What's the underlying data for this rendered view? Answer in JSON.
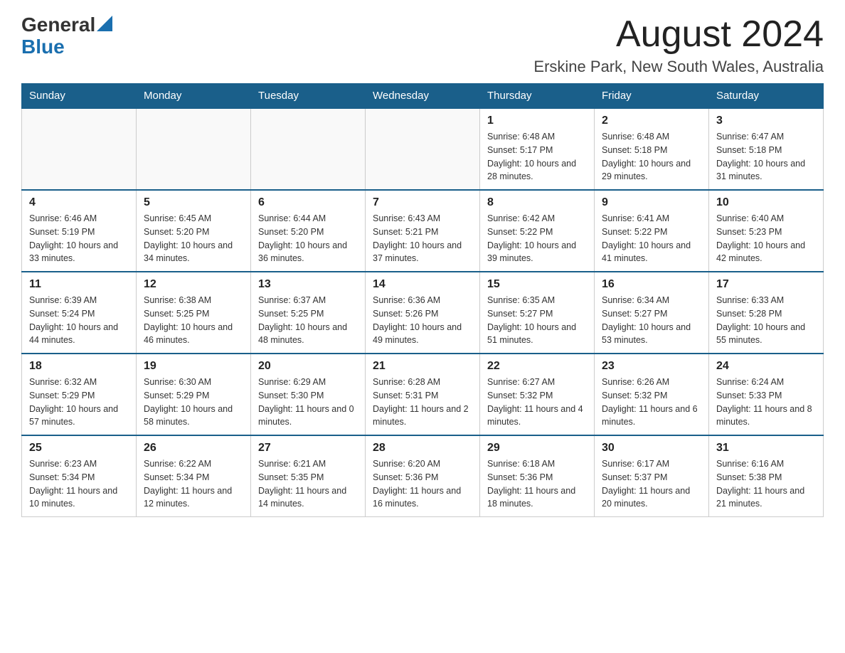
{
  "header": {
    "logo_line1": "General",
    "logo_line2": "Blue",
    "month_title": "August 2024",
    "location": "Erskine Park, New South Wales, Australia"
  },
  "weekdays": [
    "Sunday",
    "Monday",
    "Tuesday",
    "Wednesday",
    "Thursday",
    "Friday",
    "Saturday"
  ],
  "weeks": [
    [
      {
        "day": "",
        "info": ""
      },
      {
        "day": "",
        "info": ""
      },
      {
        "day": "",
        "info": ""
      },
      {
        "day": "",
        "info": ""
      },
      {
        "day": "1",
        "info": "Sunrise: 6:48 AM\nSunset: 5:17 PM\nDaylight: 10 hours and 28 minutes."
      },
      {
        "day": "2",
        "info": "Sunrise: 6:48 AM\nSunset: 5:18 PM\nDaylight: 10 hours and 29 minutes."
      },
      {
        "day": "3",
        "info": "Sunrise: 6:47 AM\nSunset: 5:18 PM\nDaylight: 10 hours and 31 minutes."
      }
    ],
    [
      {
        "day": "4",
        "info": "Sunrise: 6:46 AM\nSunset: 5:19 PM\nDaylight: 10 hours and 33 minutes."
      },
      {
        "day": "5",
        "info": "Sunrise: 6:45 AM\nSunset: 5:20 PM\nDaylight: 10 hours and 34 minutes."
      },
      {
        "day": "6",
        "info": "Sunrise: 6:44 AM\nSunset: 5:20 PM\nDaylight: 10 hours and 36 minutes."
      },
      {
        "day": "7",
        "info": "Sunrise: 6:43 AM\nSunset: 5:21 PM\nDaylight: 10 hours and 37 minutes."
      },
      {
        "day": "8",
        "info": "Sunrise: 6:42 AM\nSunset: 5:22 PM\nDaylight: 10 hours and 39 minutes."
      },
      {
        "day": "9",
        "info": "Sunrise: 6:41 AM\nSunset: 5:22 PM\nDaylight: 10 hours and 41 minutes."
      },
      {
        "day": "10",
        "info": "Sunrise: 6:40 AM\nSunset: 5:23 PM\nDaylight: 10 hours and 42 minutes."
      }
    ],
    [
      {
        "day": "11",
        "info": "Sunrise: 6:39 AM\nSunset: 5:24 PM\nDaylight: 10 hours and 44 minutes."
      },
      {
        "day": "12",
        "info": "Sunrise: 6:38 AM\nSunset: 5:25 PM\nDaylight: 10 hours and 46 minutes."
      },
      {
        "day": "13",
        "info": "Sunrise: 6:37 AM\nSunset: 5:25 PM\nDaylight: 10 hours and 48 minutes."
      },
      {
        "day": "14",
        "info": "Sunrise: 6:36 AM\nSunset: 5:26 PM\nDaylight: 10 hours and 49 minutes."
      },
      {
        "day": "15",
        "info": "Sunrise: 6:35 AM\nSunset: 5:27 PM\nDaylight: 10 hours and 51 minutes."
      },
      {
        "day": "16",
        "info": "Sunrise: 6:34 AM\nSunset: 5:27 PM\nDaylight: 10 hours and 53 minutes."
      },
      {
        "day": "17",
        "info": "Sunrise: 6:33 AM\nSunset: 5:28 PM\nDaylight: 10 hours and 55 minutes."
      }
    ],
    [
      {
        "day": "18",
        "info": "Sunrise: 6:32 AM\nSunset: 5:29 PM\nDaylight: 10 hours and 57 minutes."
      },
      {
        "day": "19",
        "info": "Sunrise: 6:30 AM\nSunset: 5:29 PM\nDaylight: 10 hours and 58 minutes."
      },
      {
        "day": "20",
        "info": "Sunrise: 6:29 AM\nSunset: 5:30 PM\nDaylight: 11 hours and 0 minutes."
      },
      {
        "day": "21",
        "info": "Sunrise: 6:28 AM\nSunset: 5:31 PM\nDaylight: 11 hours and 2 minutes."
      },
      {
        "day": "22",
        "info": "Sunrise: 6:27 AM\nSunset: 5:32 PM\nDaylight: 11 hours and 4 minutes."
      },
      {
        "day": "23",
        "info": "Sunrise: 6:26 AM\nSunset: 5:32 PM\nDaylight: 11 hours and 6 minutes."
      },
      {
        "day": "24",
        "info": "Sunrise: 6:24 AM\nSunset: 5:33 PM\nDaylight: 11 hours and 8 minutes."
      }
    ],
    [
      {
        "day": "25",
        "info": "Sunrise: 6:23 AM\nSunset: 5:34 PM\nDaylight: 11 hours and 10 minutes."
      },
      {
        "day": "26",
        "info": "Sunrise: 6:22 AM\nSunset: 5:34 PM\nDaylight: 11 hours and 12 minutes."
      },
      {
        "day": "27",
        "info": "Sunrise: 6:21 AM\nSunset: 5:35 PM\nDaylight: 11 hours and 14 minutes."
      },
      {
        "day": "28",
        "info": "Sunrise: 6:20 AM\nSunset: 5:36 PM\nDaylight: 11 hours and 16 minutes."
      },
      {
        "day": "29",
        "info": "Sunrise: 6:18 AM\nSunset: 5:36 PM\nDaylight: 11 hours and 18 minutes."
      },
      {
        "day": "30",
        "info": "Sunrise: 6:17 AM\nSunset: 5:37 PM\nDaylight: 11 hours and 20 minutes."
      },
      {
        "day": "31",
        "info": "Sunrise: 6:16 AM\nSunset: 5:38 PM\nDaylight: 11 hours and 21 minutes."
      }
    ]
  ]
}
